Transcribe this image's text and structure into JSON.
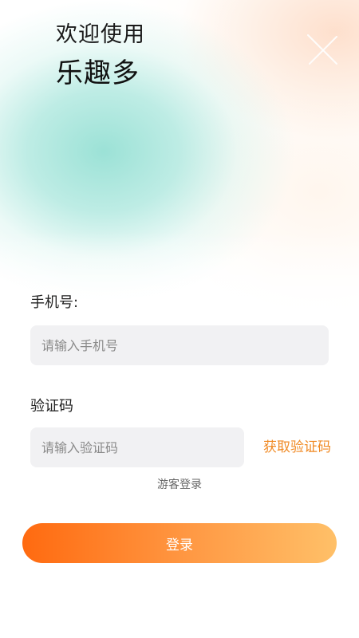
{
  "header": {
    "welcome": "欢迎使用",
    "app_name": "乐趣多"
  },
  "phone": {
    "label": "手机号:",
    "placeholder": "请输入手机号",
    "value": ""
  },
  "code": {
    "label": "验证码",
    "placeholder": "请输入验证码",
    "value": "",
    "get_code_label": "获取验证码"
  },
  "guest_login_label": "游客登录",
  "login_button_label": "登录",
  "colors": {
    "accent_orange": "#f08a24",
    "button_gradient_start": "#ff6a10",
    "button_gradient_end": "#ffc068",
    "teal_blob": "#96e0d4",
    "peach_blob": "#fddac4",
    "input_bg": "#f1f1f3"
  },
  "icons": {
    "decoration": "sparkle-icon"
  }
}
